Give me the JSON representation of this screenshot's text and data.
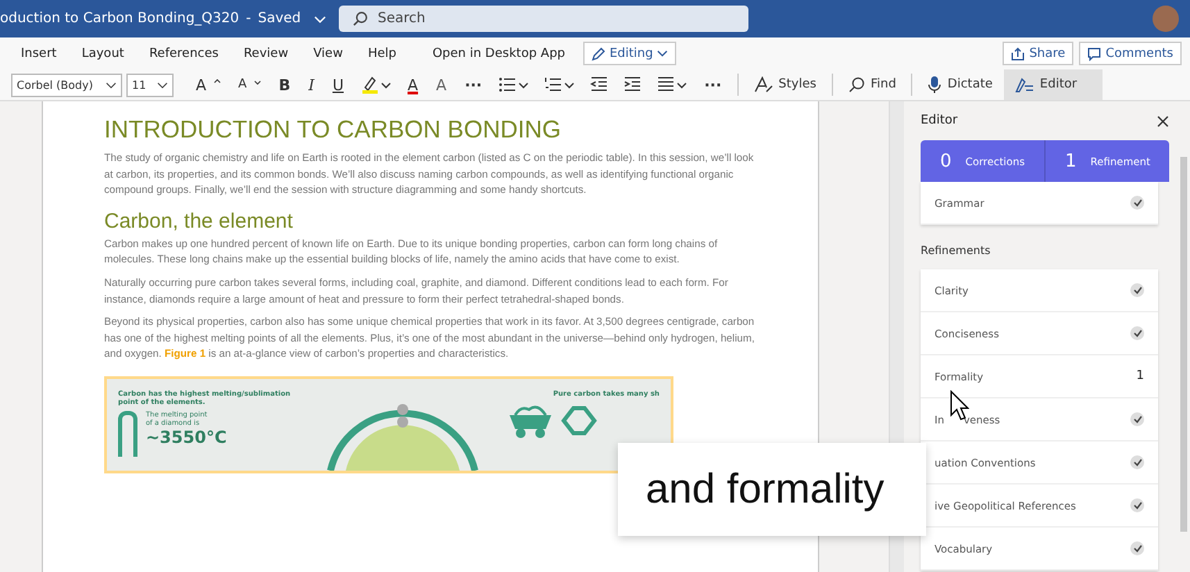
{
  "titlebar": {
    "doc_title": "oduction to Carbon Bonding_Q320",
    "separator": "-",
    "status": "Saved",
    "search_placeholder": "Search"
  },
  "menu": {
    "items": [
      {
        "label": "Insert"
      },
      {
        "label": "Layout"
      },
      {
        "label": "References"
      },
      {
        "label": "Review"
      },
      {
        "label": "View"
      },
      {
        "label": "Help"
      },
      {
        "label": "Open in Desktop App"
      }
    ],
    "mode": "Editing",
    "share": "Share",
    "comments": "Comments"
  },
  "toolbar": {
    "font": "Corbel (Body)",
    "size": "11",
    "items": [
      {
        "kind": "grow",
        "label": "A"
      },
      {
        "kind": "shrink",
        "label": "A"
      },
      {
        "kind": "bold",
        "label": "B"
      },
      {
        "kind": "italic",
        "label": "I"
      },
      {
        "kind": "underline",
        "label": "U"
      },
      {
        "kind": "highlight"
      },
      {
        "kind": "fontcolor",
        "label": "A"
      },
      {
        "kind": "clear",
        "label": "A"
      },
      {
        "kind": "more",
        "label": "···"
      },
      {
        "kind": "bullets"
      },
      {
        "kind": "numbering"
      },
      {
        "kind": "outdent"
      },
      {
        "kind": "indent"
      },
      {
        "kind": "align"
      },
      {
        "kind": "more",
        "label": "···"
      }
    ],
    "styles": "Styles",
    "find": "Find",
    "dictate": "Dictate",
    "editor": {
      "label": "Editor",
      "selected": true
    }
  },
  "document": {
    "title": "INTRODUCTION TO CARBON BONDING",
    "intro": "The study of organic chemistry and life on Earth is rooted in the element carbon (listed as C on the periodic table). In this session, we’ll look at carbon, its properties, and its common bonds. We’ll also discuss naming carbon compounds, as well as identifying functional organic compound groups. Finally, we’ll end the session with structure diagramming and some handy shortcuts.",
    "heading": "Carbon, the element",
    "paragraphs": [
      "Carbon makes up one hundred percent of known life on Earth. Due to its unique bonding properties, carbon can form long chains of molecules. These long chains make up the essential building blocks of life, namely the amino acids that have come to exist.",
      "Naturally occurring pure carbon takes several forms, including coal, graphite, and diamond. Different conditions lead to each form. For instance, diamonds require a large amount of heat and pressure to form their perfect tetrahedral-shaped bonds.",
      "Beyond its physical properties, carbon also has some unique chemical properties that work in its favor. At 3,500 degrees centigrade, carbon has one of the highest melting points of all the elements. Plus, it’s one of the most abundant in the universe—behind only hydrogen, helium, and oxygen. **Figure 1** is an at-a-glance view of carbon’s properties and characteristics."
    ],
    "figure": {
      "left_caption": "Carbon has the highest melting/sublimation point of the elements.",
      "melting_label": "The melting point of a diamond is",
      "melting_value": "~3550°C",
      "right_caption": "Pure carbon takes many sh"
    }
  },
  "editor_pane": {
    "title": "Editor",
    "corrections_count": "0",
    "corrections_label": "Corrections",
    "refinement_count": "1",
    "refinement_label": "Refinement",
    "grammar": {
      "label": "Grammar",
      "kind": "check"
    },
    "refinements_heading": "Refinements",
    "refinements": [
      {
        "label": "Clarity",
        "kind": "check"
      },
      {
        "label": "Conciseness",
        "kind": "check"
      },
      {
        "label": "Formality",
        "kind": "count",
        "count": "1"
      },
      {
        "label": "In",
        "label_after": "veness",
        "kind": "check"
      },
      {
        "label": "uation Conventions",
        "kind": "check"
      },
      {
        "label": "ive Geopolitical References",
        "kind": "check"
      },
      {
        "label": "Vocabulary",
        "kind": "check"
      }
    ]
  },
  "caption_overlay": "and formality"
}
